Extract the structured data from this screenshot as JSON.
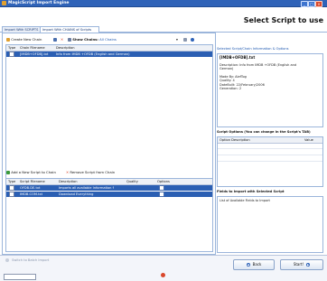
{
  "window": {
    "title": "MagicScript Import Engine"
  },
  "header": {
    "heading": "Select Script to use"
  },
  "tabs": [
    "Import With SCRIPTS",
    "Import With CHAINS of Scripts"
  ],
  "toolbar": {
    "create_label": "Create New Chain",
    "show_label": "Show Chains:",
    "show_value": "All Chains"
  },
  "chains_table": {
    "columns": [
      "Type",
      "Chain Filename",
      "Description"
    ],
    "rows": [
      {
        "filename": "[IMDB+OFDB].txt",
        "description": "Info from IMDB +OFDB (English and German)"
      }
    ]
  },
  "midbar": {
    "add_label": "Add a New Script to Chain",
    "remove_label": "Remove Script from Chain"
  },
  "scripts_table": {
    "columns": [
      "Type",
      "Script Filename",
      "Description",
      "Quality",
      "Options"
    ],
    "rows": [
      {
        "filename": "OFDB.DE.txt",
        "description": "Imports all available Information f",
        "quality": 4
      },
      {
        "filename": "IMDB.COM.txt",
        "description": "Download Everything",
        "quality": 5
      }
    ]
  },
  "details": {
    "title": "Selected Script/Chain Information & Options",
    "name": "[IMDB+OFDB].txt",
    "lines": [
      "Description: Info from IMDB +OFDB (English and",
      "German)",
      "",
      "Made By: AlefTog",
      "Quality: 4",
      "DateBuilt: 22/February/2006",
      "Generation: 2"
    ]
  },
  "options": {
    "title": "Script Options (You can change in the Script's TAB)",
    "col_desc": "Option Description",
    "col_value": "Value"
  },
  "fields": {
    "title": "Fields to Import with Selected Script",
    "list_label": "List of Available Fields to Import"
  },
  "footer": {
    "switch_label": "Switch to Batch Import",
    "back_label": "Back",
    "start_label": "Start!",
    "progress": 0.0
  },
  "colors": {
    "titlebar": "#2f63b8",
    "selection": "#2b5fb3",
    "accent_text": "#1d57b0"
  }
}
